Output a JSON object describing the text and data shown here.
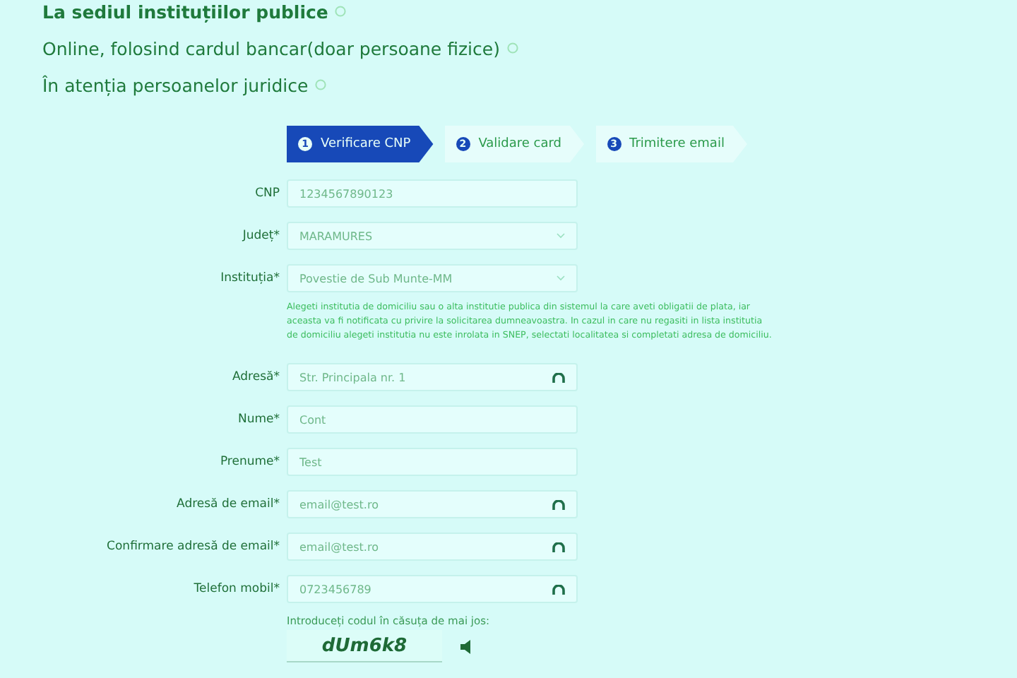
{
  "payment_options": [
    {
      "label": "La sediul instituțiilor publice",
      "bold": true
    },
    {
      "label": "Online, folosind cardul bancar(doar persoane fizice)",
      "bold": false
    },
    {
      "label": "În atenția persoanelor juridice",
      "bold": false
    }
  ],
  "steps": [
    {
      "number": "1",
      "label": "Verificare CNP",
      "selected": true
    },
    {
      "number": "2",
      "label": "Validare card",
      "selected": false
    },
    {
      "number": "3",
      "label": "Trimitere email",
      "selected": false
    }
  ],
  "fields": [
    {
      "label": "CNP",
      "value": "1234567890123",
      "kind": "input",
      "icon": false
    },
    {
      "label": "Județ*",
      "value": "MARAMURES",
      "kind": "select",
      "icon": false
    },
    {
      "label": "Instituția*",
      "value": "Povestie de Sub Munte-MM",
      "kind": "select",
      "icon": false,
      "help": "Alegeti institutia de domiciliu sau o alta institutie publica din sistemul la care aveti obligatii de plata, iar aceasta va fi notificata cu privire la solicitarea dumneavoastra. In cazul in care nu regasiti in lista institutia de domiciliu alegeti institutia nu este inrolata in SNEP, selectati localitatea si completati adresa de domiciliu."
    },
    {
      "label": "Adresă*",
      "value": "Str. Principala nr. 1",
      "kind": "input",
      "icon": true
    },
    {
      "label": "Nume*",
      "value": "Cont",
      "kind": "input",
      "icon": false
    },
    {
      "label": "Prenume*",
      "value": "Test",
      "kind": "input",
      "icon": false
    },
    {
      "label": "Adresă de email*",
      "value": "email@test.ro",
      "kind": "input",
      "icon": true
    },
    {
      "label": "Confirmare adresă de email*",
      "value": "email@test.ro",
      "kind": "input",
      "icon": true
    },
    {
      "label": "Telefon mobil*",
      "value": "0723456789",
      "kind": "input",
      "icon": true
    }
  ],
  "captcha": {
    "prompt": "Introduceți codul în căsuța de mai jos:",
    "code": "dUm6k8"
  }
}
